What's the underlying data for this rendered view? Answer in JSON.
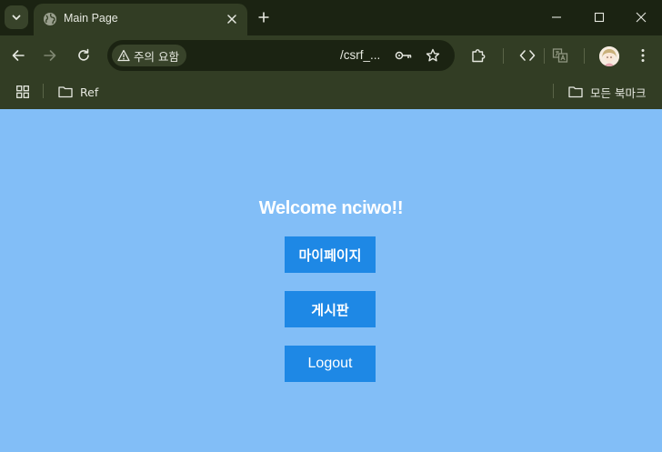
{
  "browser": {
    "tab": {
      "title": "Main Page",
      "favicon": "globe-icon"
    },
    "address_bar": {
      "security_label": "주의 요함",
      "url": "/csrf_..."
    },
    "bookmarks": [
      {
        "label": "Ref",
        "icon": "folder-icon"
      }
    ],
    "all_bookmarks_label": "모든 북마크"
  },
  "page": {
    "welcome_text": "Welcome nciwo!!",
    "buttons": {
      "mypage": "마이페이지",
      "board": "게시판",
      "logout": "Logout"
    }
  },
  "colors": {
    "page_background": "#82bef7",
    "button_background": "#1e88e5",
    "browser_frame": "#323d24",
    "browser_titlebar": "#1b2312"
  }
}
